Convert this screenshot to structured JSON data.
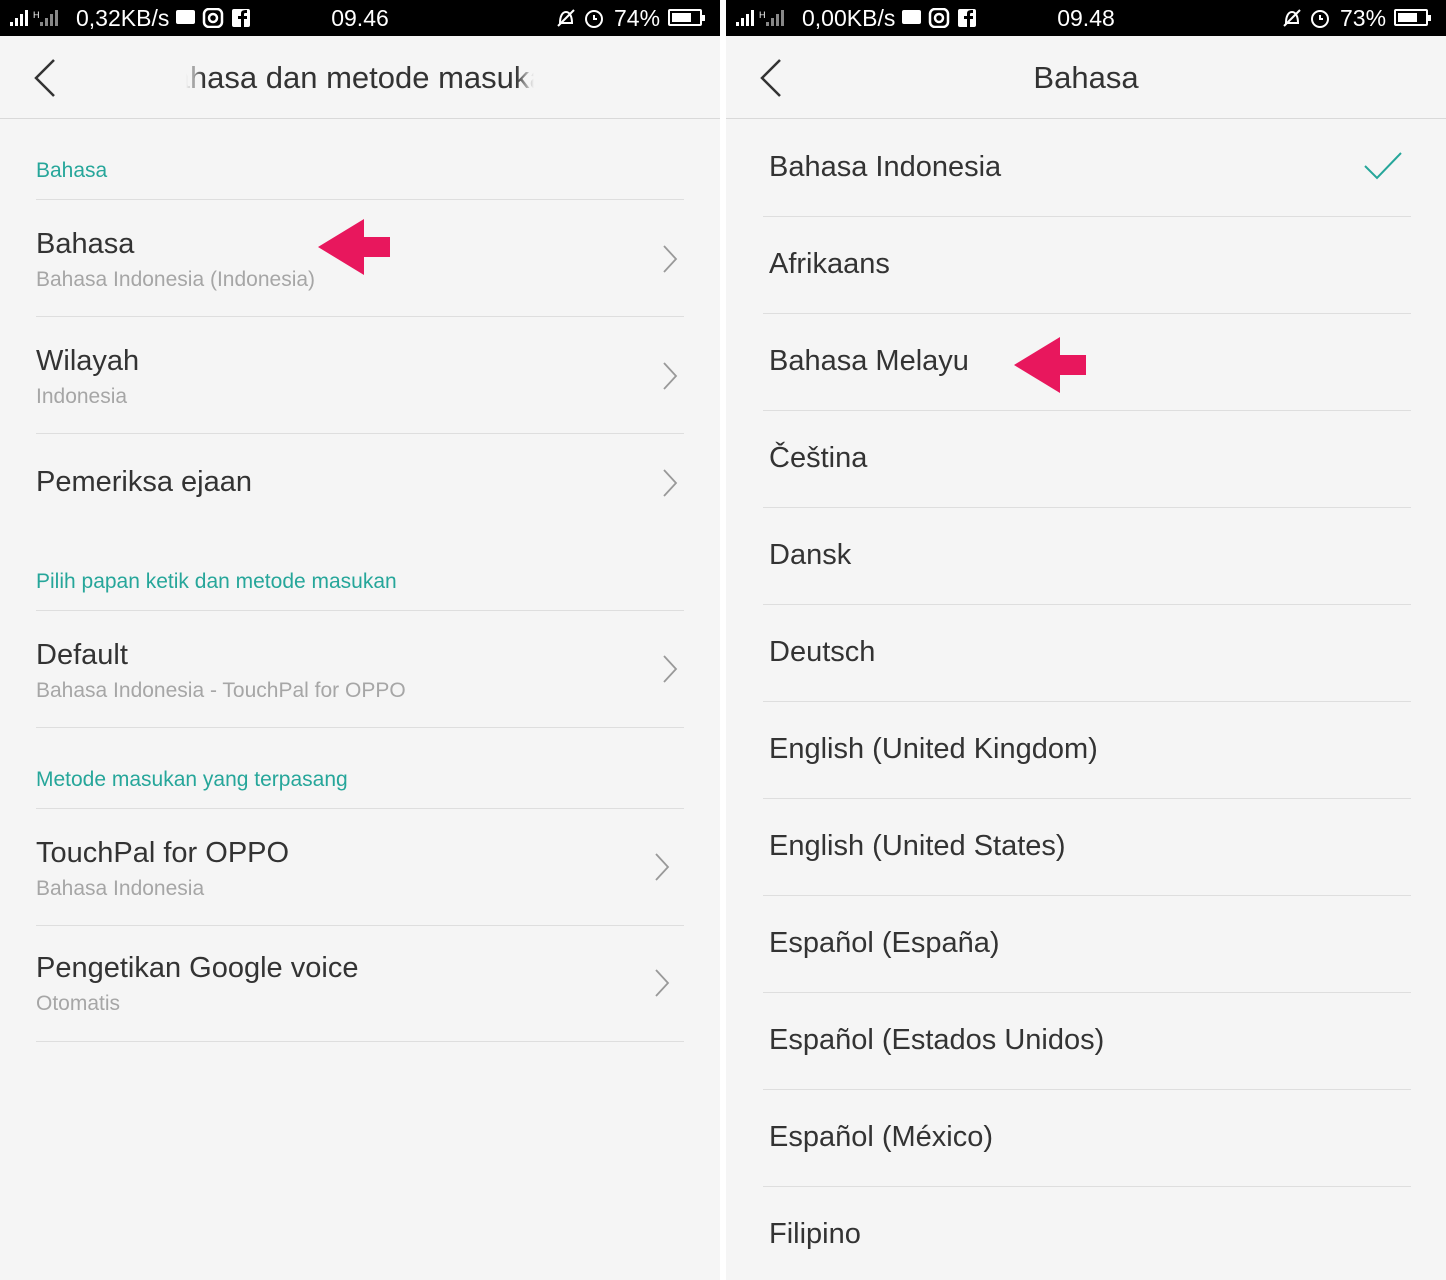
{
  "left": {
    "status": {
      "net_speed": "0,32KB/s",
      "time": "09.46",
      "battery": "74%",
      "battery_level": 0.74
    },
    "title": "Bahasa dan metode masukan",
    "sections": [
      {
        "header": "Bahasa"
      },
      {
        "header": "Pilih papan ketik dan metode masukan"
      },
      {
        "header": "Metode masukan yang terpasang"
      }
    ],
    "rows": [
      {
        "label": "Bahasa",
        "sub": "Bahasa Indonesia (Indonesia)"
      },
      {
        "label": "Wilayah",
        "sub": "Indonesia"
      },
      {
        "label": "Pemeriksa ejaan"
      },
      {
        "label": "Default",
        "sub": "Bahasa Indonesia - TouchPal for OPPO"
      },
      {
        "label": "TouchPal for OPPO",
        "sub": "Bahasa Indonesia"
      },
      {
        "label": "Pengetikan Google voice",
        "sub": "Otomatis"
      }
    ]
  },
  "right": {
    "status": {
      "net_speed": "0,00KB/s",
      "time": "09.48",
      "battery": "73%",
      "battery_level": 0.73
    },
    "title": "Bahasa",
    "languages": [
      "Bahasa Indonesia",
      "Afrikaans",
      "Bahasa Melayu",
      "Čeština",
      "Dansk",
      "Deutsch",
      "English (United Kingdom)",
      "English (United States)",
      "Español (España)",
      "Español (Estados Unidos)",
      "Español (México)",
      "Filipino"
    ],
    "selected_language": "Bahasa Indonesia"
  },
  "colors": {
    "accent": "#26a69a",
    "annotation_arrow": "#e8175d",
    "background": "#f5f5f5"
  }
}
